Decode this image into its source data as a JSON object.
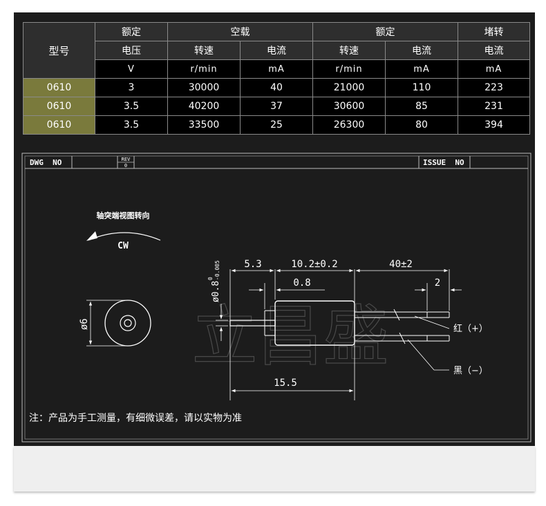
{
  "table": {
    "header_row1": {
      "model": "型号",
      "rated1": "额定",
      "noload": "空载",
      "rated2": "额定",
      "stall": "堵转"
    },
    "header_row2": {
      "voltage": "电压",
      "noload_speed": "转速",
      "noload_current": "电流",
      "rated_speed": "转速",
      "rated_current": "电流",
      "stall_current": "电流"
    },
    "units": [
      "V",
      "r/min",
      "mA",
      "r/min",
      "mA",
      "mA"
    ],
    "rows": [
      {
        "model": "0610",
        "voltage": "3",
        "noload_speed": "30000",
        "noload_current": "40",
        "rated_speed": "21000",
        "rated_current": "110",
        "stall_current": "223"
      },
      {
        "model": "0610",
        "voltage": "3.5",
        "noload_speed": "40200",
        "noload_current": "37",
        "rated_speed": "30600",
        "rated_current": "85",
        "stall_current": "231"
      },
      {
        "model": "0610",
        "voltage": "3.5",
        "noload_speed": "33500",
        "noload_current": "25",
        "rated_speed": "26300",
        "rated_current": "80",
        "stall_current": "394"
      }
    ]
  },
  "drawing": {
    "dwg_label": "DWG  NO",
    "rev_label": "REV",
    "rev_value": "0",
    "issue_label": "ISSUE  NO",
    "rotation_title": "轴突端视图转向",
    "rotation_dir": "CW",
    "diameter": "ø6",
    "shaft_dia": "ø0.8",
    "shaft_tol_upper": "0",
    "shaft_tol_lower": "-0.005",
    "dim_shaft": "5.3",
    "dim_body": "10.2±0.2",
    "dim_lead": "40±2",
    "dim_shoulder": "0.8",
    "dim_strip": "2",
    "dim_total": "15.5",
    "wire_red": "红（+）",
    "wire_black": "黑（−）",
    "watermark": "立昌盛",
    "note": "注：产品为手工测量，有细微误差，请以实物为准"
  }
}
